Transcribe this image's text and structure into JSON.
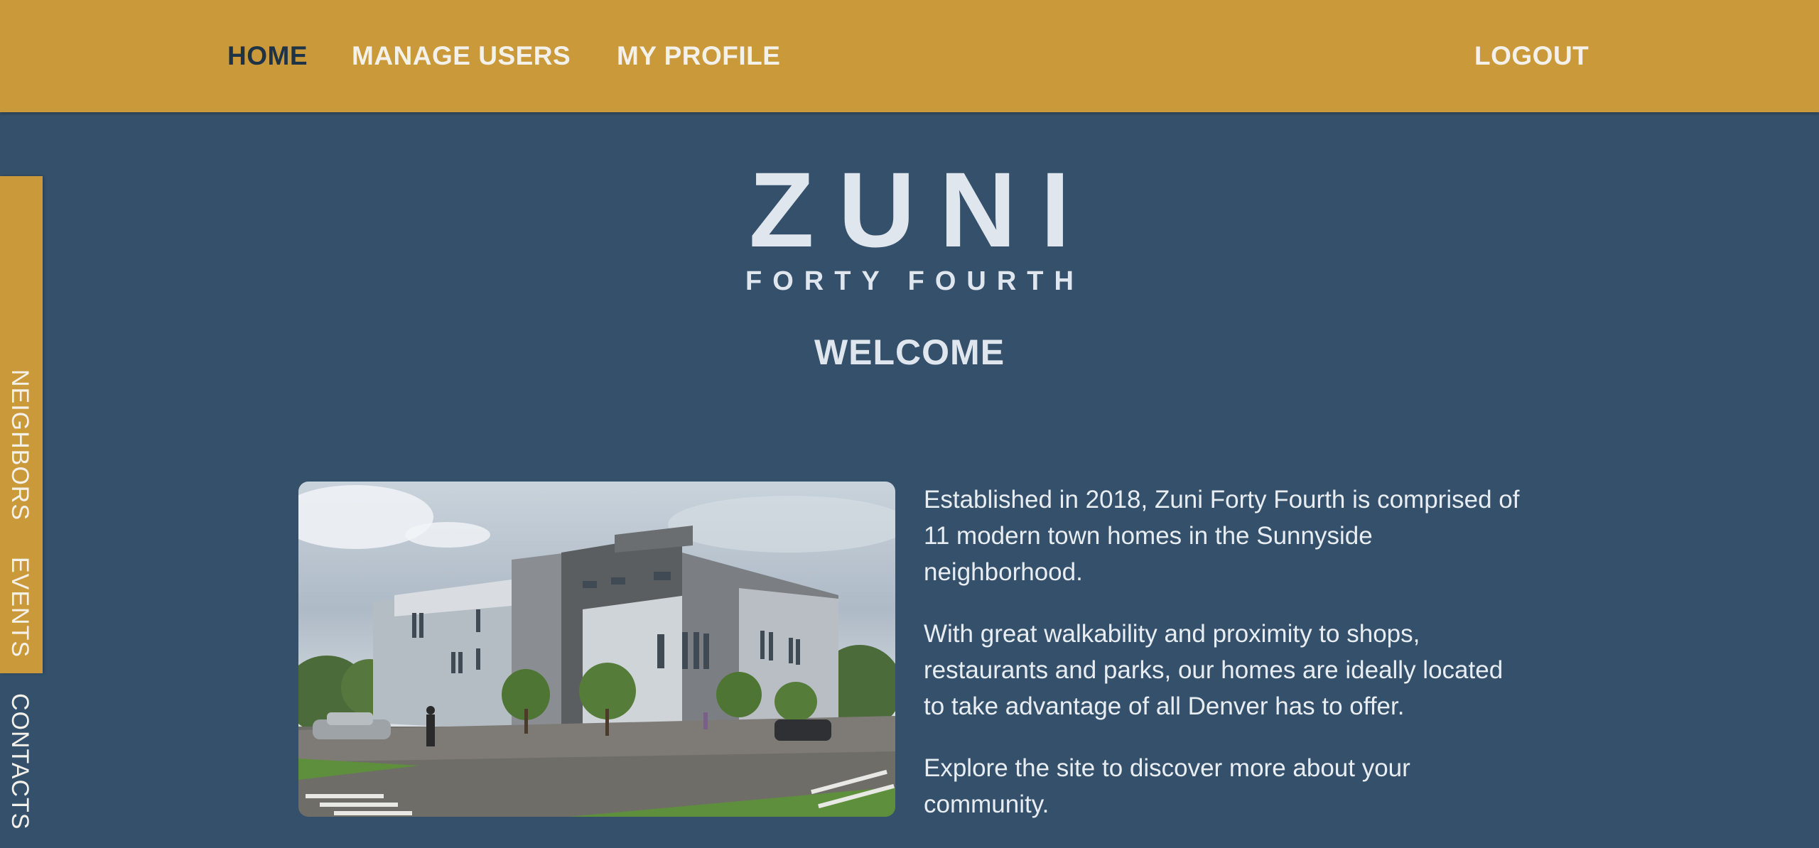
{
  "nav": {
    "home": "HOME",
    "manage_users": "MANAGE USERS",
    "my_profile": "MY PROFILE",
    "logout": "LOGOUT",
    "active": "HOME"
  },
  "side_tabs": {
    "neighbors": "NEIGHBORS",
    "events": "EVENTS",
    "contacts": "CONTACTS"
  },
  "logo": {
    "main": "ZUNI",
    "sub": "FORTY FOURTH"
  },
  "welcome": "WELCOME",
  "intro": {
    "paragraphs": [
      "Established in 2018, Zuni Forty Fourth is comprised of 11 modern town homes in the Sunnyside neighborhood.",
      "With great walkability and proximity to shops, restaurants and parks, our homes are ideally located to take advantage of all Denver has to offer.",
      "Explore the site to discover more about your community."
    ]
  },
  "colors": {
    "background": "#35506a",
    "accent": "#c9993a",
    "active_nav_text": "#1f3346",
    "light_text": "#dfe6ee"
  }
}
